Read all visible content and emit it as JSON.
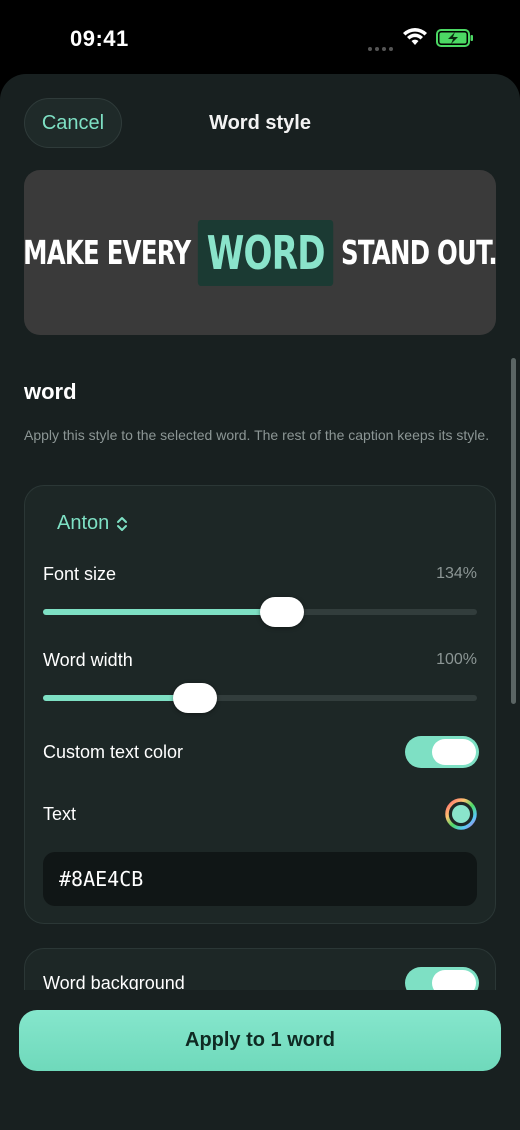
{
  "status_bar": {
    "time": "09:41"
  },
  "header": {
    "cancel_label": "Cancel",
    "title": "Word style"
  },
  "preview": {
    "before": "MAKE EVERY",
    "highlight": "WORD",
    "after": "STAND OUT."
  },
  "section": {
    "heading": "word",
    "description": "Apply this style to the selected word. The rest of the caption keeps its style."
  },
  "settings": {
    "font_name": "Anton",
    "font_size": {
      "label": "Font size",
      "value": "134%",
      "level": 0.55
    },
    "word_width": {
      "label": "Word width",
      "value": "100%",
      "level": 0.35
    },
    "custom_text_color": {
      "label": "Custom text color",
      "on": true
    },
    "text_color": {
      "label": "Text",
      "hex": "#8AE4CB"
    }
  },
  "background": {
    "label": "Word background",
    "on": true
  },
  "footer": {
    "apply_label": "Apply to 1 word"
  },
  "colors": {
    "accent": "#7EE0C4",
    "highlight_text": "#8AE4CB",
    "sheet_bg": "#182020"
  }
}
